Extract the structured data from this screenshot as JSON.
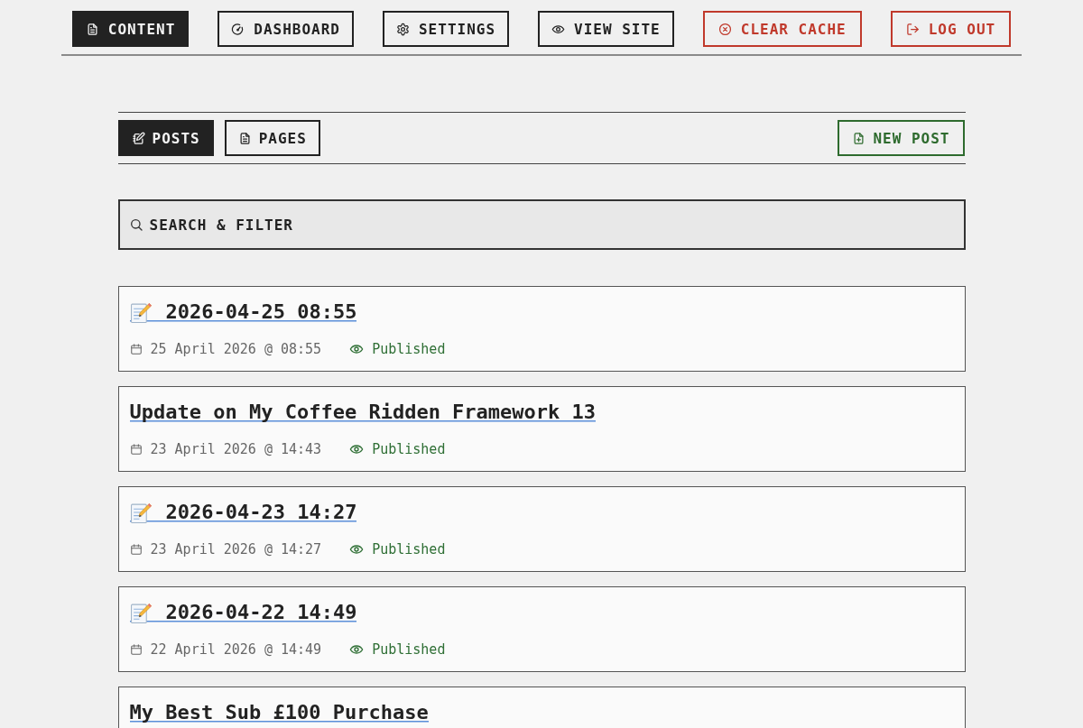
{
  "top_nav": {
    "tabs": [
      {
        "label": "CONTENT",
        "selected": true
      },
      {
        "label": "DASHBOARD",
        "selected": false
      },
      {
        "label": "SETTINGS",
        "selected": false
      },
      {
        "label": "VIEW SITE",
        "selected": false
      }
    ],
    "actions": [
      {
        "label": "CLEAR CACHE"
      },
      {
        "label": "LOG OUT"
      }
    ]
  },
  "content_tabs": [
    {
      "label": "POSTS",
      "selected": true
    },
    {
      "label": "PAGES",
      "selected": false
    }
  ],
  "new_post_button": {
    "label": "NEW POST"
  },
  "search_filter": {
    "label": "SEARCH & FILTER"
  },
  "posts": [
    {
      "kind": "memo",
      "title": "2026-04-25 08:55",
      "date": "25 April 2026 @ 08:55",
      "status": "Published"
    },
    {
      "kind": "plain",
      "title": "Update on My Coffee Ridden Framework 13",
      "date": "23 April 2026 @ 14:43",
      "status": "Published"
    },
    {
      "kind": "memo",
      "title": "2026-04-23 14:27",
      "date": "23 April 2026 @ 14:27",
      "status": "Published"
    },
    {
      "kind": "memo",
      "title": "2026-04-22 14:49",
      "date": "22 April 2026 @ 14:49",
      "status": "Published"
    },
    {
      "kind": "plain",
      "title": "My Best Sub £100 Purchase"
    }
  ]
}
